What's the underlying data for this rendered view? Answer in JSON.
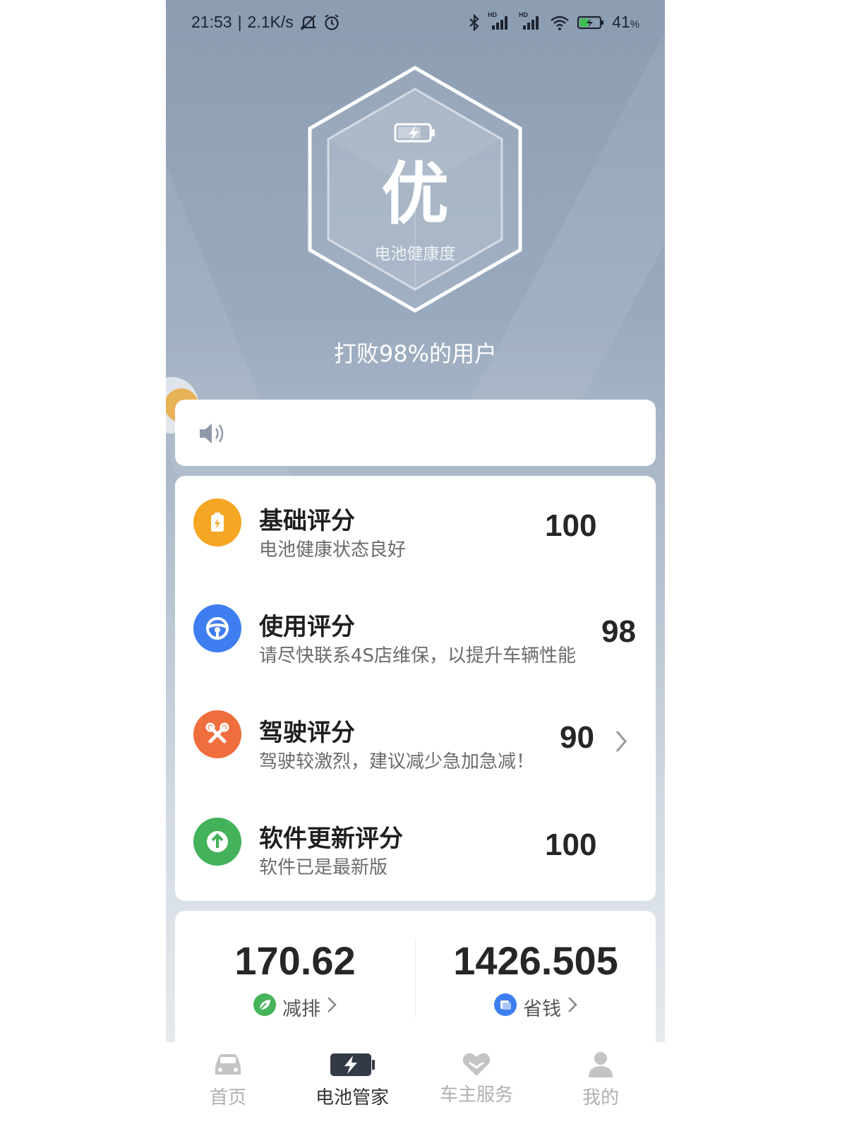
{
  "status_bar": {
    "time": "21:53",
    "separator": "|",
    "net_speed": "2.1K/s",
    "battery_percent": "41",
    "battery_unit": "%",
    "sim1_badge": "HD",
    "sim2_badge": "HD",
    "icons": [
      "mute-icon",
      "alarm-icon",
      "bluetooth-icon",
      "signal-icon",
      "wifi-icon",
      "battery-charging-icon"
    ]
  },
  "hero": {
    "grade": "优",
    "grade_label": "电池健康度",
    "beat_text": "打败98%的用户",
    "battery_fill": 0.75
  },
  "notice": {
    "icon": "speaker-icon",
    "text": ""
  },
  "scores": [
    {
      "title": "基础评分",
      "desc": "电池健康状态良好",
      "value": "100",
      "icon": "battery-charge-icon",
      "color": "#f5a623",
      "has_arrow": false
    },
    {
      "title": "使用评分",
      "desc": "请尽快联系4S店维保，以提升车辆性能",
      "value": "98",
      "icon": "steering-wheel-icon",
      "color": "#3f7ef0",
      "has_arrow": false
    },
    {
      "title": "驾驶评分",
      "desc": "驾驶较激烈，建议减少急加急减！",
      "value": "90",
      "icon": "wrench-icon",
      "color": "#ee6e3d",
      "has_arrow": true
    },
    {
      "title": "软件更新评分",
      "desc": "软件已是最新版",
      "value": "100",
      "icon": "upload-arrow-icon",
      "color": "#43b25a",
      "has_arrow": false
    }
  ],
  "stats": [
    {
      "value": "170.62",
      "label": "减排",
      "icon": "leaf-icon",
      "color": "#47b45b"
    },
    {
      "value": "1426.505",
      "label": "省钱",
      "icon": "coin-icon",
      "color": "#3d7ef0"
    }
  ],
  "nav": [
    {
      "label": "首页",
      "icon": "car-icon",
      "active": false
    },
    {
      "label": "电池管家",
      "icon": "battery-bolt-icon",
      "active": true
    },
    {
      "label": "车主服务",
      "icon": "heart-service-icon",
      "active": false
    },
    {
      "label": "我的",
      "icon": "person-icon",
      "active": false
    }
  ],
  "colors": {
    "hero_top": "#8c9db2",
    "card_bg": "#ffffff",
    "nav_active": "#333333",
    "nav_inactive": "#b0b0b0"
  }
}
